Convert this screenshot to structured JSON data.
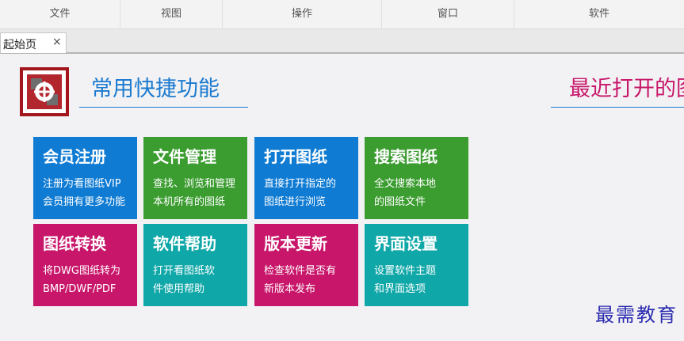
{
  "menubar": {
    "items": [
      "文件",
      "视图",
      "操作",
      "窗口",
      "软件"
    ]
  },
  "tabs": [
    {
      "label": "起始页",
      "close": "×"
    }
  ],
  "quick": {
    "title": "常用快捷功能",
    "tiles": [
      {
        "title": "会员注册",
        "desc": "注册为看图纸VIP\n会员拥有更多功能",
        "color": "#0f7bd3"
      },
      {
        "title": "文件管理",
        "desc": "查找、浏览和管理\n本机所有的图纸",
        "color": "#3b9c30"
      },
      {
        "title": "打开图纸",
        "desc": "直接打开指定的\n图纸进行浏览",
        "color": "#0f7bd3"
      },
      {
        "title": "搜索图纸",
        "desc": "全文搜索本地\n的图纸文件",
        "color": "#3b9c30"
      },
      {
        "title": "图纸转换",
        "desc": "将DWG图纸转为\nBMP/DWF/PDF",
        "color": "#c8166a"
      },
      {
        "title": "软件帮助",
        "desc": "打开看图纸软\n件使用帮助",
        "color": "#10a7a8"
      },
      {
        "title": "版本更新",
        "desc": "检查软件是否有\n新版本发布",
        "color": "#c8166a"
      },
      {
        "title": "界面设置",
        "desc": "设置软件主题\n和界面选项",
        "color": "#10a7a8"
      }
    ]
  },
  "recent": {
    "title": "最近打开的图"
  },
  "watermark": "最需教育",
  "colors": {
    "blue": "#1b7ad0",
    "magenta": "#c8166a"
  }
}
